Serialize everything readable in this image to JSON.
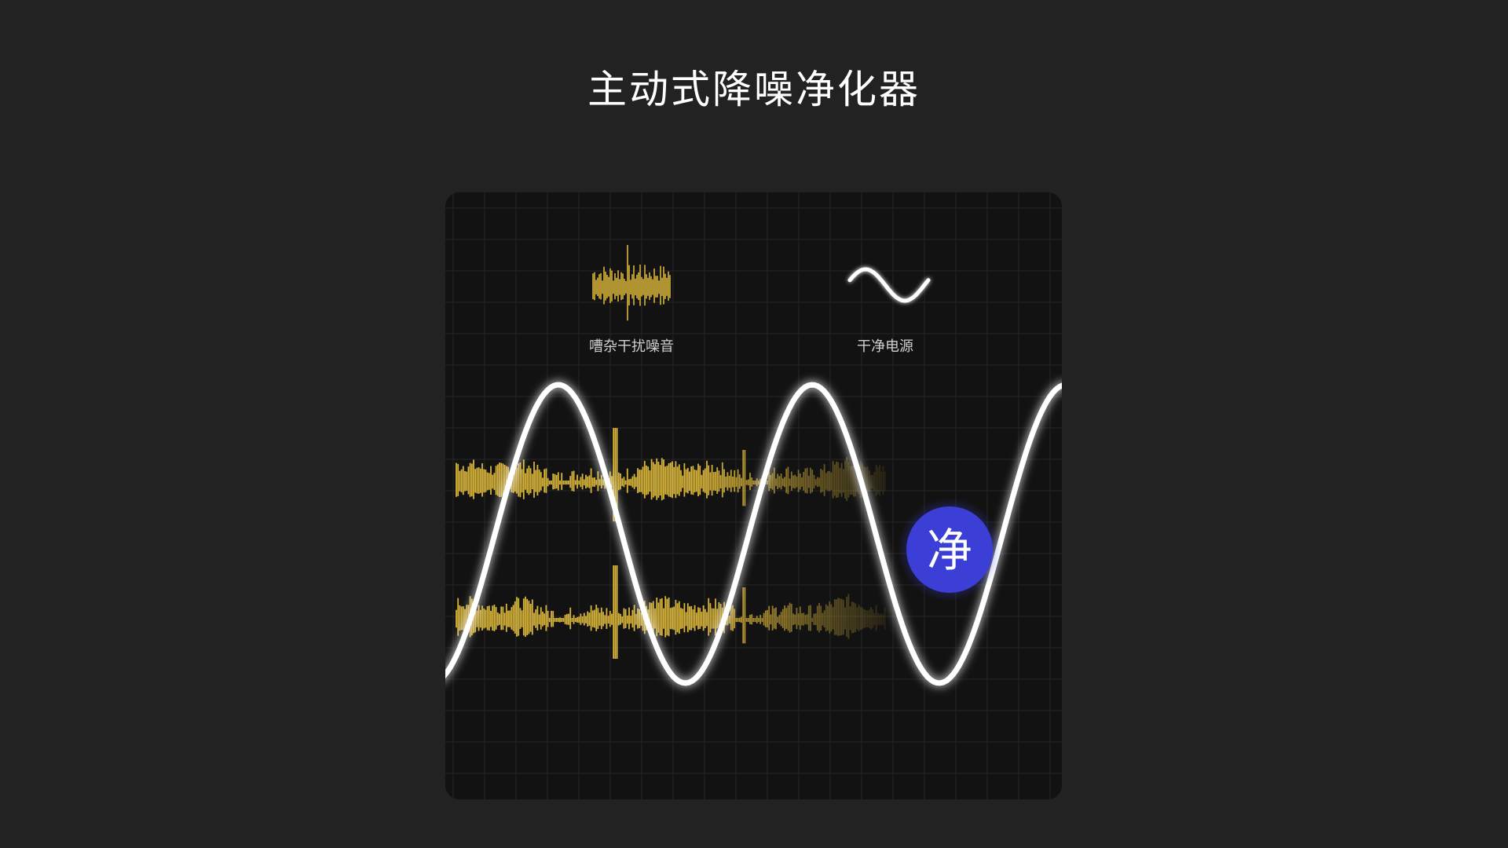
{
  "header": {
    "title": "主动式降噪净化器"
  },
  "legend": {
    "noise_label": "嘈杂干扰噪音",
    "clean_label": "干净电源"
  },
  "badge": {
    "char": "净"
  },
  "colors": {
    "background": "#222222",
    "panel": "#121212",
    "noise_wave": "#d9b53a",
    "sine_wave": "#ffffff",
    "badge": "#3b3fd6"
  },
  "icons": {
    "noise": "noise-waveform-icon",
    "clean": "sine-wave-icon"
  }
}
